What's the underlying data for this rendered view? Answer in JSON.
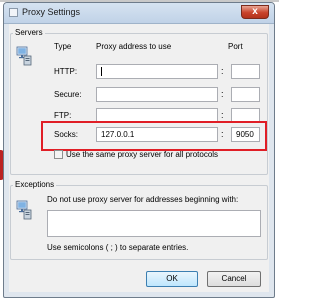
{
  "window": {
    "title": "Proxy Settings",
    "close_label": "x"
  },
  "servers": {
    "group_label": "Servers",
    "col_type": "Type",
    "col_address": "Proxy address to use",
    "col_port": "Port",
    "rows": [
      {
        "label": "HTTP:",
        "address": "",
        "port": ""
      },
      {
        "label": "Secure:",
        "address": "",
        "port": ""
      },
      {
        "label": "FTP:",
        "address": "",
        "port": ""
      },
      {
        "label": "Socks:",
        "address": "127.0.0.1",
        "port": "9050"
      }
    ],
    "separator": ":",
    "same_proxy_label": "Use the same proxy server for all protocols"
  },
  "exceptions": {
    "group_label": "Exceptions",
    "description": "Do not use proxy server for addresses beginning with:",
    "hint": "Use semicolons ( ; ) to separate entries.",
    "value": ""
  },
  "buttons": {
    "ok": "OK",
    "cancel": "Cancel"
  },
  "colors": {
    "highlight": "#e01e26",
    "dialog_bg": "#f0f0f0",
    "title_bg": "#c8d8ea"
  }
}
